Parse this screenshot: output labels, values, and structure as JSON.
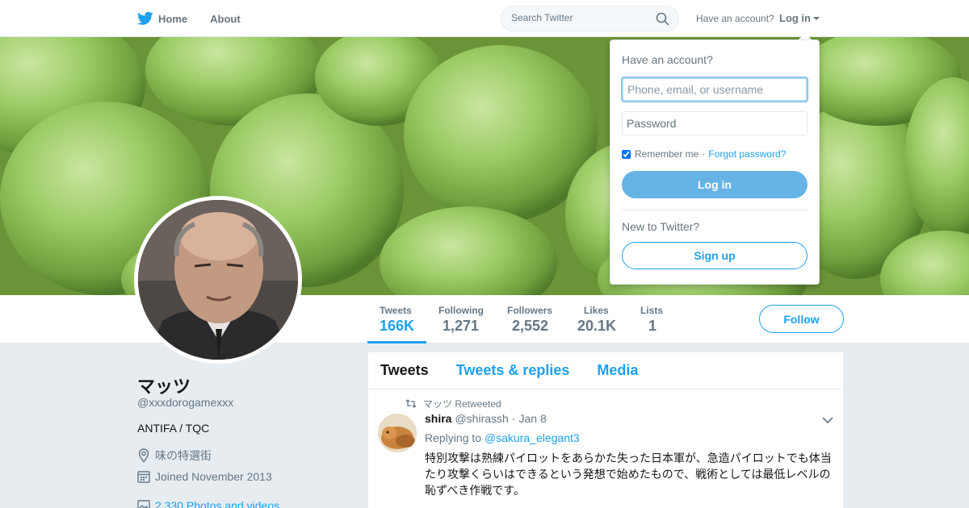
{
  "nav": {
    "home_label": "Home",
    "about_label": "About",
    "search_placeholder": "Search Twitter",
    "account_hint": "Have an account?",
    "login_label": "Log in"
  },
  "profile": {
    "name": "マッツ",
    "handle": "@xxxdorogamexxx",
    "bio": "ANTIFA / TQC",
    "location": "味の特選街",
    "joined": "Joined November 2013",
    "photos_videos": "2,330 Photos and videos",
    "follow_label": "Follow"
  },
  "stats": [
    {
      "label": "Tweets",
      "value": "166K"
    },
    {
      "label": "Following",
      "value": "1,271"
    },
    {
      "label": "Followers",
      "value": "2,552"
    },
    {
      "label": "Likes",
      "value": "20.1K"
    },
    {
      "label": "Lists",
      "value": "1"
    }
  ],
  "timeline": {
    "tabs": [
      "Tweets",
      "Tweets & replies",
      "Media"
    ],
    "tweet": {
      "retweeted_by": "マッツ Retweeted",
      "name": "shira",
      "username": "@shirassh",
      "separator": "·",
      "date": "Jan 8",
      "replying_to_prefix": "Replying to",
      "replying_to": "@sakura_elegant3",
      "text": "特別攻撃は熟練パイロットをあらかた失った日本軍が、急造パイロットでも体当たり攻撃くらいはできるという発想で始めたもので、戦術としては最低レベルの恥ずべき作戦です。"
    }
  },
  "login_dropdown": {
    "title": "Have an account?",
    "username_placeholder": "Phone, email, or username",
    "password_placeholder": "Password",
    "remember_label": "Remember me",
    "separator": "·",
    "forgot_label": "Forgot password?",
    "login_button": "Log in",
    "new_label": "New to Twitter?",
    "signup_button": "Sign up"
  },
  "colors": {
    "accent": "#1da1f2",
    "page_bg": "#e6ecf0",
    "login_button_bg": "#66b3e6",
    "banner_green": "#7ea848"
  }
}
